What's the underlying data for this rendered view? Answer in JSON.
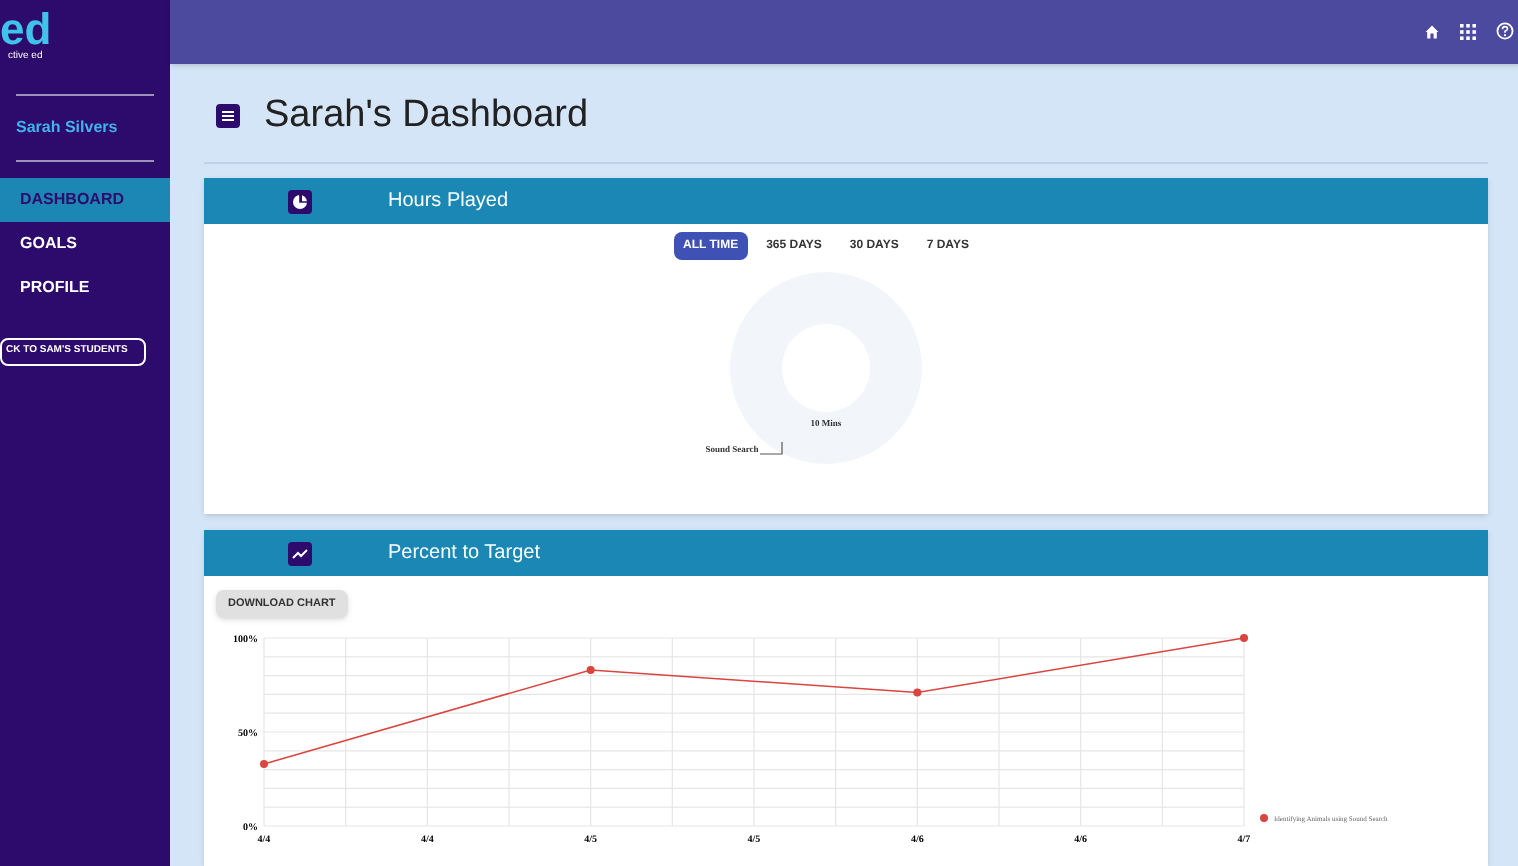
{
  "sidebar": {
    "logo": "ed",
    "logo_tagline": "ctive ed",
    "user": "Sarah Silvers",
    "items": [
      {
        "label": "DASHBOARD",
        "selected": true
      },
      {
        "label": "GOALS",
        "selected": false
      },
      {
        "label": "PROFILE",
        "selected": false
      }
    ],
    "back_button": "CK TO SAM'S STUDENTS"
  },
  "page_title": "Sarah's Dashboard",
  "hours_played": {
    "title": "Hours Played",
    "ranges": [
      {
        "label": "ALL TIME",
        "selected": true
      },
      {
        "label": "365 DAYS",
        "selected": false
      },
      {
        "label": "30 DAYS",
        "selected": false
      },
      {
        "label": "7 DAYS",
        "selected": false
      }
    ],
    "donut_value": "10 Mins",
    "donut_legend": "Sound Search"
  },
  "percent_to_target": {
    "title": "Percent to Target",
    "download_button": "DOWNLOAD CHART",
    "chart_data": {
      "type": "line",
      "categories": [
        "4/4",
        "4/4",
        "4/5",
        "4/5",
        "4/6",
        "4/6",
        "4/7"
      ],
      "series": [
        {
          "name": "Identifying Animals using Sound Search",
          "color": "#d9453f",
          "marker": true,
          "values": [
            33,
            null,
            83,
            null,
            71,
            null,
            100
          ]
        }
      ],
      "grid": true,
      "ylim": [
        0,
        100
      ],
      "yticks": [
        {
          "value": 0,
          "label": "0%"
        },
        {
          "value": 50,
          "label": "50%"
        },
        {
          "value": 100,
          "label": "100%"
        }
      ]
    }
  }
}
